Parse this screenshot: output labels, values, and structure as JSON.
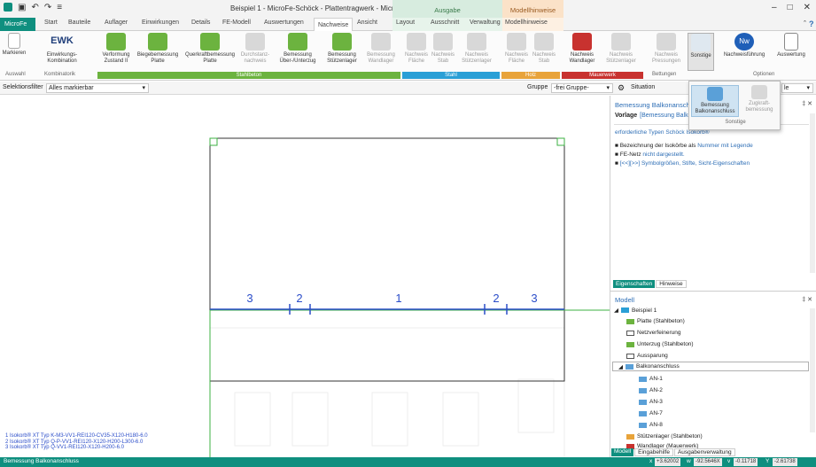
{
  "window": {
    "title": "Beispiel 1 - MicroFe-Schöck - Plattentragwerk - MicroFe 2023",
    "ctx_ausgabe": "Ausgabe",
    "ctx_modellhinweise": "Modellhinweise"
  },
  "tabs": [
    "MicroFe",
    "Start",
    "Bauteile",
    "Auflager",
    "Einwirkungen",
    "Details",
    "FE-Modell",
    "Auswertungen",
    "Nachweise",
    "Ansicht",
    "Layout",
    "Ausschnitt",
    "Verwaltung",
    "Modellhinweise"
  ],
  "ribbon": {
    "markieren": "Markieren",
    "ewk": "EWK",
    "einwirkungs": "Einwirkungs-\nKombination",
    "verformung": "Verformung\nZustand II",
    "biegebemessung": "Biegebemessung\nPlatte",
    "querkraft": "Querkraftbemessung\nPlatte",
    "durchstanz": "Durchstanz-\nnachweis",
    "bem_ueber": "Bemessung\nÜber-/Unterzug",
    "bem_stuetzen": "Bemessung\nStützenlager",
    "bem_wand": "Bemessung\nWandlager",
    "nw_flaeche": "Nachweis\nFläche",
    "nw_stab": "Nachweis\nStab",
    "nw_stuetzen": "Nachweis\nStützenlager",
    "nw_flaeche2": "Nachweis\nFläche",
    "nw_stab2": "Nachweis\nStab",
    "nw_wand": "Nachweis\nWandlager",
    "nw_stuetz2": "Nachweis\nStützenlager",
    "nw_pressungen": "Nachweis\nPressungen",
    "sonstige": "Sonstige",
    "nachweisfuehrung": "Nachweisführung",
    "auswertung": "Auswertung",
    "groups": {
      "auswahl": "Auswahl",
      "kombinatorik": "Kombinatorik",
      "stahlbeton": "Stahlbeton",
      "stahl": "Stahl",
      "holz": "Holz",
      "mauerwerk": "Mauerwerk",
      "bettungen": "Bettungen",
      "optionen": "Optionen"
    }
  },
  "dropdown": {
    "bem_balkon": "Bemessung\nBalkonanschluss",
    "zugkraft": "Zugkraft-\nbemessung",
    "group": "Sonstige"
  },
  "filterbar": {
    "sel_label": "Selektionsfilter",
    "sel_value": "Alles markierbar",
    "gruppe_label": "Gruppe",
    "gruppe_value": "-frei Gruppe-",
    "situation": "Situation",
    "search_tail": "le"
  },
  "canvas": {
    "dim_labels": [
      "3",
      "2",
      "1",
      "2",
      "3"
    ],
    "legend": [
      "1  Isokorb® XT Typ K-M3-VV1-REI120-CV35-X120-H180-6.0",
      "2  Isokorb® XT Typ Q-P-VV1-REI120-X120-H200-L300-6.0",
      "3  Isokorb® XT Typ Q-VV1-REI120-X120-H200-6.0"
    ]
  },
  "props": {
    "title": "Bemessung Balkonanschl",
    "vorlage_label": "Vorlage",
    "vorlage_value": "[Bemessung Balkon",
    "link": "erforderliche Typen Schöck Isokorb®",
    "lines": [
      "Bezeichnung der Isokörbe als",
      "FE-Netz",
      "[<<][>>] Symbolgrößen, Stifte, Sicht-Eigenschaften"
    ],
    "line1_link": "Nummer mit Legende",
    "line2_link": "nicht dargestellt.",
    "tabs": [
      "Eigenschaften",
      "Hinweise"
    ]
  },
  "model": {
    "title": "Modell",
    "items": [
      "Beispiel 1",
      "Platte (Stahlbeton)",
      "Netzverfeinerung",
      "Unterzug (Stahlbeton)",
      "Aussparung",
      "Balkonanschluss",
      "AN-1",
      "AN-2",
      "AN-3",
      "AN-7",
      "AN-8",
      "Stützenlager (Stahlbeton)",
      "Wandlager (Mauerwerk)"
    ],
    "tabs": [
      "Modell",
      "Eingabehilfe",
      "Ausgabenverwaltung"
    ]
  },
  "status": {
    "text": "Bemessung Balkonanschluss",
    "x_label": "x",
    "x": "+3.62002",
    "w_label": "w",
    "w": "-92.5646X",
    "v_label": "v",
    "v": "-0.11718",
    "y_label": "Y",
    "y": "-2.61738"
  },
  "colors": {
    "accent": "#0f8f7f",
    "stahlbeton": "#6cb33f",
    "stahl": "#2a9fd6",
    "holz": "#e8a33a",
    "mauerwerk": "#c8322f",
    "slab_line": "#3cb043",
    "dim_text": "#2b4dc9"
  }
}
